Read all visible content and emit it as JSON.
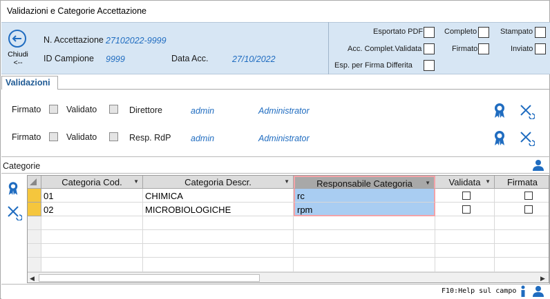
{
  "window": {
    "title": "Validazioni e Categorie Accettazione"
  },
  "header": {
    "close_label": "Chiudi",
    "close_sub": "<--",
    "n_accettazione_label": "N. Accettazione",
    "n_accettazione_value": "27102022-9999",
    "id_campione_label": "ID Campione",
    "id_campione_value": "9999",
    "data_acc_label": "Data Acc.",
    "data_acc_value": "27/10/2022",
    "flags": {
      "esportato_pdf": "Esportato PDF",
      "completo": "Completo",
      "stampato": "Stampato",
      "acc_complet_validata": "Acc. Complet.Validata",
      "firmato": "Firmato",
      "inviato": "Inviato",
      "esp_firma_differita": "Esp. per Firma Differita"
    }
  },
  "validazioni": {
    "tab_label": "Validazioni",
    "rows": [
      {
        "firmato": "Firmato",
        "validato": "Validato",
        "role": "Direttore",
        "user": "admin",
        "name": "Administrator"
      },
      {
        "firmato": "Firmato",
        "validato": "Validato",
        "role": "Resp. RdP",
        "user": "admin",
        "name": "Administrator"
      }
    ]
  },
  "categorie": {
    "section_label": "Categorie",
    "columns": [
      "Categoria Cod.",
      "Categoria Descr.",
      "Responsabile Categoria",
      "Validata",
      "Firmata"
    ],
    "rows": [
      {
        "cod": "01",
        "descr": "CHIMICA",
        "resp": "rc"
      },
      {
        "cod": "02",
        "descr": "MICROBIOLOGICHE",
        "resp": "rpm"
      }
    ]
  },
  "status": {
    "help": "F10:Help sul campo"
  },
  "colors": {
    "header_bg": "#d7e6f4",
    "accent": "#1f6cc0",
    "row_marker": "#f5c63d",
    "selection": "#a9cdf2"
  }
}
